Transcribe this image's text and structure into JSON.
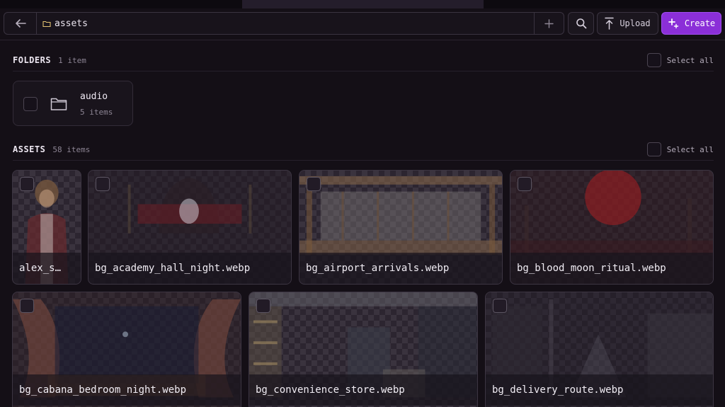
{
  "toolbar": {
    "path": "assets",
    "upload_label": "Upload",
    "create_label": "Create"
  },
  "folders": {
    "title": "FOLDERS",
    "count": "1 item",
    "select_all": "Select all",
    "items": [
      {
        "name": "audio",
        "count": "5 items"
      }
    ]
  },
  "assets": {
    "title": "ASSETS",
    "count": "58 items",
    "select_all": "Select all",
    "items": [
      {
        "name": "alex_s…"
      },
      {
        "name": "bg_academy_hall_night.webp"
      },
      {
        "name": "bg_airport_arrivals.webp"
      },
      {
        "name": "bg_blood_moon_ritual.webp"
      },
      {
        "name": "bg_cabana_bedroom_night.webp"
      },
      {
        "name": "bg_convenience_store.webp"
      },
      {
        "name": "bg_delivery_route.webp"
      }
    ]
  },
  "colors": {
    "accent": "#8b2fd8",
    "background": "#140f16"
  }
}
